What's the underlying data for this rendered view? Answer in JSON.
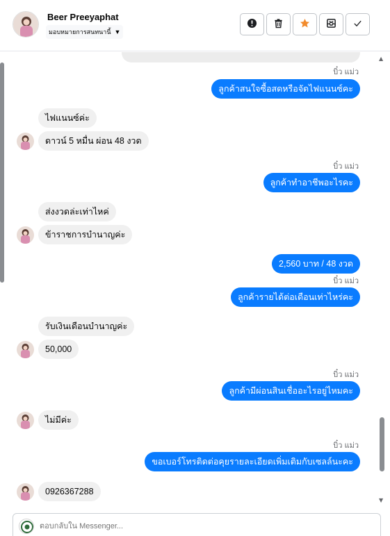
{
  "contact": {
    "name": "Beer Preeyaphat",
    "assign_label": "มอบหมายการสนทนานี้"
  },
  "actions": [
    {
      "name": "alert-icon"
    },
    {
      "name": "trash-icon"
    },
    {
      "name": "star-icon",
      "color": "#f28b2c"
    },
    {
      "name": "archive-icon"
    },
    {
      "name": "check-icon"
    }
  ],
  "colors": {
    "outgoing_bubble": "#0a7cff",
    "incoming_bubble": "#f0f0f0",
    "star": "#f28b2c"
  },
  "messages": [
    {
      "seen": "บิ๋ว แม่ว",
      "text": "ลูกค้าสนใจซื้อสดหรือจัดไฟแนนซ์คะ"
    },
    {
      "text": "ไฟแนนซ์ค่ะ"
    },
    {
      "text": "ดาวน์ 5 หมื่น ผ่อน 48 งวด"
    },
    {
      "seen": "บิ๋ว แม่ว",
      "text": "ลูกค้าทำอาชีพอะไรคะ"
    },
    {
      "text": "ส่งงวดล่ะเท่าไหค่"
    },
    {
      "text": "ข้าราชการบำนาญค่ะ"
    },
    {
      "text": "2,560 บาท  / 48 งวด"
    },
    {
      "seen": "บิ๋ว แม่ว",
      "text": "ลูกค้ารายได้ต่อเดือนเท่าไหร่คะ"
    },
    {
      "text": "รับเงินเดือนบำนาญค่ะ"
    },
    {
      "text": "50,000"
    },
    {
      "seen": "บิ๋ว แม่ว",
      "text": "ลูกค้ามีผ่อนสินเชื่ออะไรอยู่ไหมคะ"
    },
    {
      "text": "ไม่มีค่ะ"
    },
    {
      "seen": "บิ๋ว แม่ว",
      "text": "ขอเบอร์โทรติดต่อคุยรายละเอียดเพิ่มเติมกับเซลล์นะคะ"
    },
    {
      "text": "0926367288"
    }
  ],
  "composer": {
    "placeholder": "ตอบกลับใน Messenger..."
  }
}
